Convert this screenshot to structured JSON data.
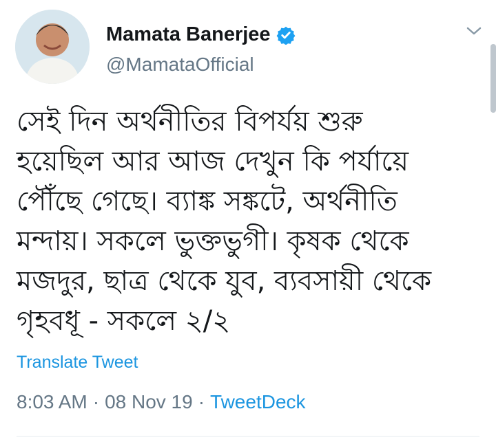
{
  "author": {
    "name": "Mamata Banerjee",
    "handle": "@MamataOfficial",
    "avatar_icon": "profile-avatar",
    "verified": true
  },
  "tweet": {
    "lines": [
      "সেই দিন অর্থনীতির বিপর্যয় শুরু",
      "হয়েছিল আর আজ দেখুন কি পর্যায়ে",
      "পৌঁছে গেছে। ব্যাঙ্ক সঙ্কটে, অর্থনীতি",
      "মন্দায়। সকলে ভুক্তভুগী। কৃষক থেকে",
      "মজদুর, ছাত্র থেকে যুব, ব্যবসায়ী থেকে",
      "গৃহবধূ - সকলে ২/২"
    ],
    "translate_label": "Translate Tweet"
  },
  "meta": {
    "time": "8:03 AM",
    "separator": "·",
    "date": "08 Nov 19",
    "source": "TweetDeck"
  },
  "colors": {
    "link": "#1b95e0",
    "muted": "#657786",
    "text": "#14171a"
  }
}
